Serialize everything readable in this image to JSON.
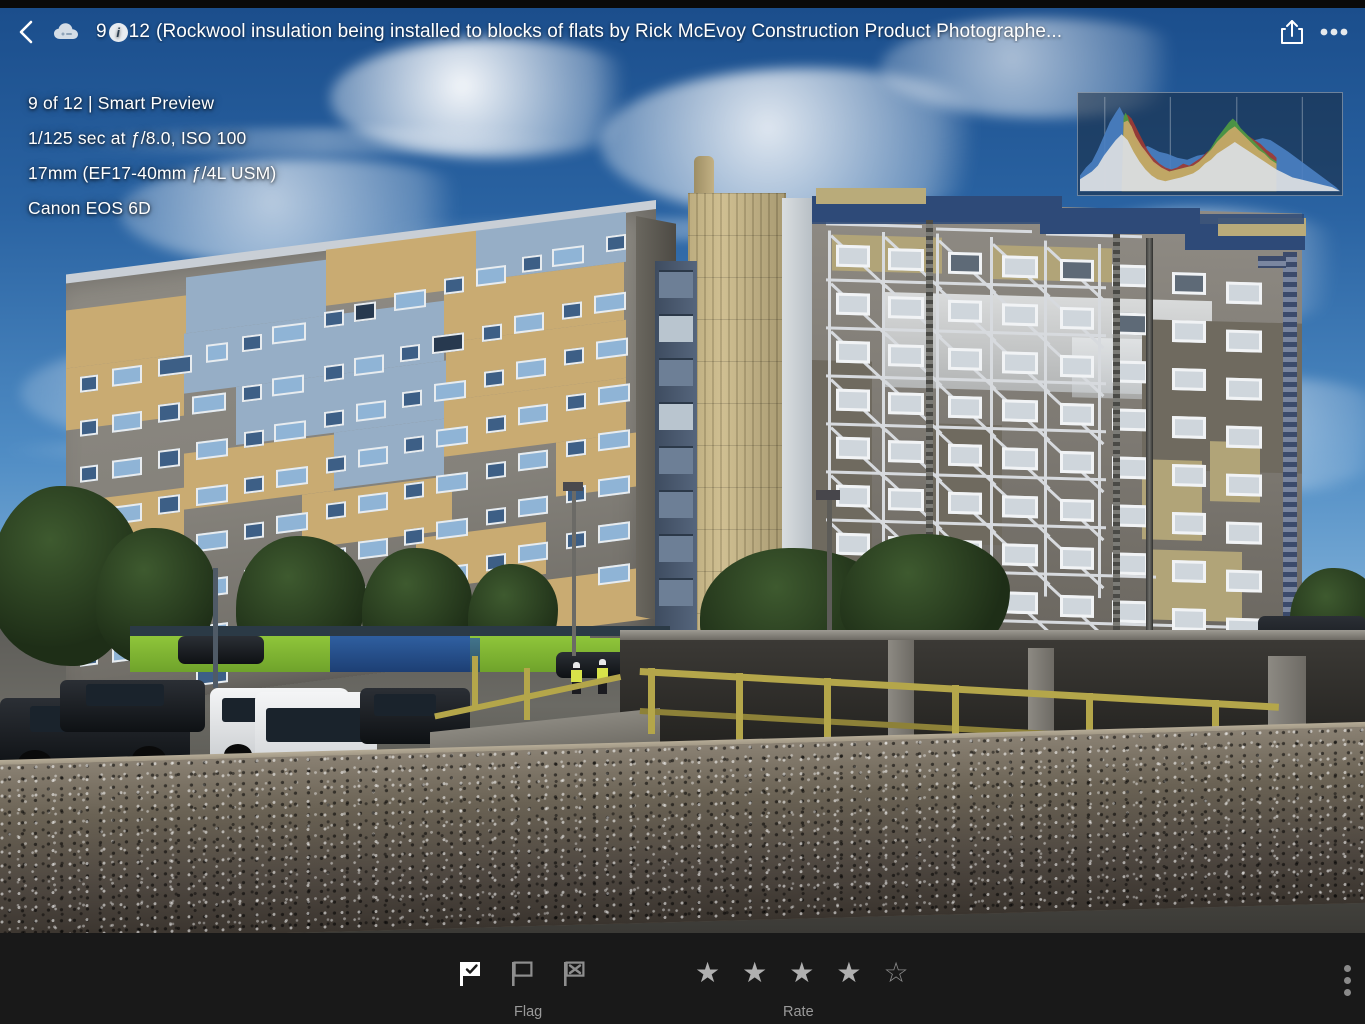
{
  "app": {
    "titlebar": {
      "back_icon": "back-chevron-icon",
      "cloud_icon": "cloud-sync-icon",
      "count_prefix": "9",
      "badge_glyph": "i",
      "count_suffix": "12",
      "title": "(Rockwool insulation being installed to blocks of flats by Rick McEvoy Construction Product Photographe...",
      "share_icon": "share-icon",
      "more_icon": "more-horizontal-icon"
    },
    "overlay_metadata": {
      "lines": [
        "9 of 12 | Smart Preview",
        "1/125 sec at ƒ/8.0, ISO 100",
        "17mm (EF17-40mm ƒ/4L USM)",
        "Canon EOS 6D"
      ]
    },
    "histogram": {
      "name": "histogram-panel",
      "channels": [
        "red",
        "green",
        "blue",
        "luminance"
      ],
      "colors": {
        "luminance": "#d9dcdf",
        "red": "#9e3a33",
        "green": "#4f9a42",
        "blue": "#4a7fc1",
        "yellow": "#c6a867",
        "panel_bg": "#1b2430",
        "border": "#c2cad4"
      }
    },
    "bottombar": {
      "flag_label": "Flag",
      "rate_label": "Rate",
      "flags": [
        {
          "name": "flag-picked",
          "state": "selected"
        },
        {
          "name": "flag-unflagged",
          "state": "normal"
        },
        {
          "name": "flag-rejected",
          "state": "normal"
        }
      ],
      "rating": 4,
      "stars_total": 5,
      "star_filled_glyph": "★",
      "star_empty_glyph": "☆",
      "more_icon": "more-vertical-icon"
    },
    "colors": {
      "bottom_bar_bg": "#191919",
      "top_strip_bg": "#0a0a0a",
      "overlay_text": "#ffffff",
      "muted_text": "#9a9a9a"
    }
  },
  "photo": {
    "name": "construction-photograph",
    "subject": "Rockwool insulation being installed to blocks of flats",
    "elements": {
      "sky": "blue sky with scattered white clouds",
      "left_building": "nine-storey block of flats with beige, blue and grey cladding panels",
      "centre_tower": "beige ribbed lift/stair core with chimney flue and blue glazed stairwell",
      "right_building": "high-rise tower wrapped in scaffolding with insulation panels and protective sheeting",
      "foreground": "pebble-dash concrete wall, yellow handrail, car park with cars and white vans, green site hoarding, two workers in hi-vis"
    }
  }
}
